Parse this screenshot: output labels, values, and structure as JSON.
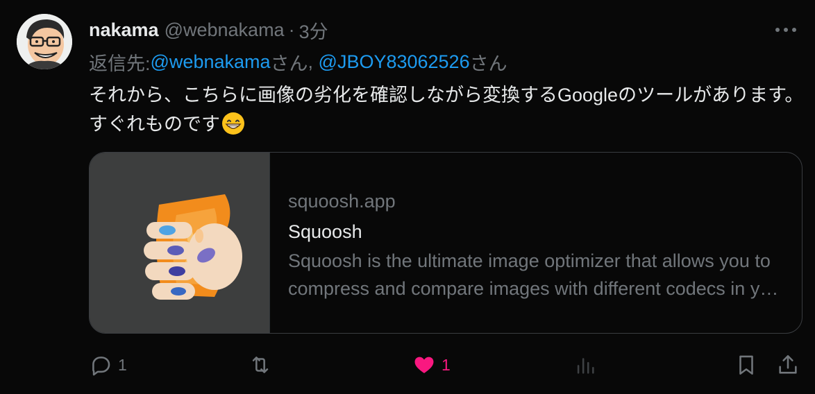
{
  "author": {
    "name": "nakama",
    "handle": "@webnakama",
    "separator": "·",
    "time": "3分"
  },
  "reply": {
    "prefix": "返信先: ",
    "mentions": [
      "@webnakama",
      "@JBOY83062526"
    ],
    "suffix": "さん",
    "joiner": ", "
  },
  "text": "それから、こちらに画像の劣化を確認しながら変換するGoogleのツールがあります。すぐれものです",
  "emoji": "grinning-face-with-smiling-eyes",
  "card": {
    "domain": "squoosh.app",
    "title": "Squoosh",
    "description": "Squoosh is the ultimate image optimizer that allows you to compress and compare images with different codecs in your browser."
  },
  "actions": {
    "reply_count": "1",
    "retweet_count": "",
    "like_count": "1",
    "views_count": ""
  },
  "colors": {
    "background": "#080808",
    "text": "#e7e9ea",
    "muted": "#71767b",
    "link": "#1d9bf0",
    "like": "#f91880",
    "card_border": "#3a3d41"
  }
}
